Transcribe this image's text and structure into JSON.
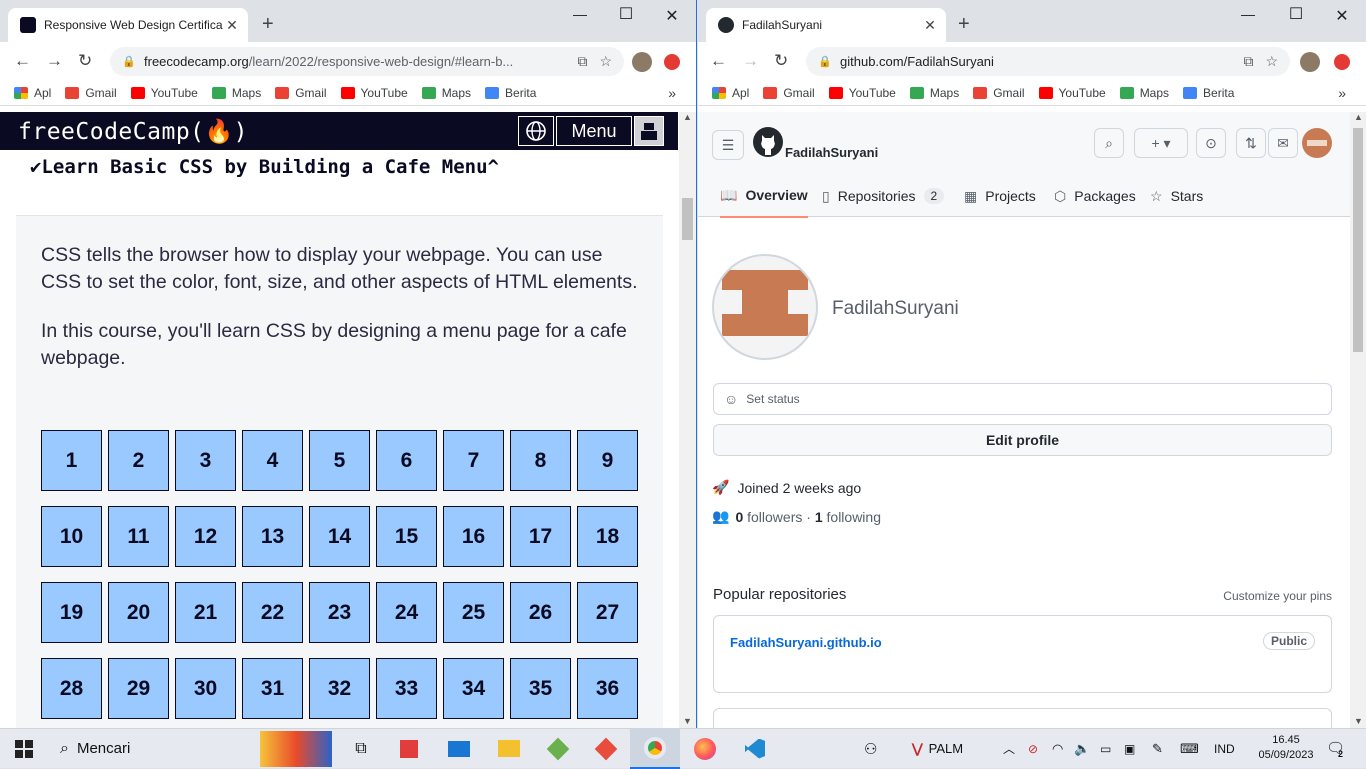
{
  "left_browser": {
    "tab_title": "Responsive Web Design Certifica",
    "url_host": "freecodecamp.org",
    "url_path": "/learn/2022/responsive-web-design/#learn-b...",
    "bookmarks": [
      "Apl",
      "Gmail",
      "YouTube",
      "Maps",
      "Gmail",
      "YouTube",
      "Maps",
      "Berita"
    ],
    "page": {
      "logo": "freeCodeCamp(🔥)",
      "menu_label": "Menu",
      "course_title": "✔Learn Basic CSS by Building a Cafe Menu^",
      "para1": "CSS tells the browser how to display your webpage. You can use CSS to set the color, font, size, and other aspects of HTML elements.",
      "para2": "In this course, you'll learn CSS by designing a menu page for a cafe webpage.",
      "steps": [
        "1",
        "2",
        "3",
        "4",
        "5",
        "6",
        "7",
        "8",
        "9",
        "10",
        "11",
        "12",
        "13",
        "14",
        "15",
        "16",
        "17",
        "18",
        "19",
        "20",
        "21",
        "22",
        "23",
        "24",
        "25",
        "26",
        "27",
        "28",
        "29",
        "30",
        "31",
        "32",
        "33",
        "34",
        "35",
        "36"
      ]
    }
  },
  "right_browser": {
    "tab_title": "FadilahSuryani",
    "url": "github.com/FadilahSuryani",
    "bookmarks": [
      "Apl",
      "Gmail",
      "YouTube",
      "Maps",
      "Gmail",
      "YouTube",
      "Maps",
      "Berita"
    ],
    "page": {
      "username_header": "FadilahSuryani",
      "tabs": [
        {
          "label": "Overview",
          "icon": "book-icon"
        },
        {
          "label": "Repositories",
          "icon": "repo-icon",
          "count": "2"
        },
        {
          "label": "Projects",
          "icon": "table-icon"
        },
        {
          "label": "Packages",
          "icon": "package-icon"
        },
        {
          "label": "Stars",
          "icon": "star-icon"
        }
      ],
      "profile_name": "FadilahSuryani",
      "set_status": "Set status",
      "edit_profile": "Edit profile",
      "joined": "Joined 2 weeks ago",
      "followers_count": "0",
      "followers_label": "followers",
      "following_count": "1",
      "following_label": "following",
      "popular_title": "Popular repositories",
      "customize": "Customize your pins",
      "repo_name": "FadilahSuryani.github.io",
      "repo_badge": "Public"
    }
  },
  "taskbar": {
    "search_label": "Mencari",
    "tray_app": "PALM",
    "lang": "IND",
    "time": "16.45",
    "date": "05/09/2023",
    "notif_count": "2"
  },
  "colors": {
    "fcc_nav": "#0a0a23",
    "fcc_cell": "#99c9ff",
    "gh_link": "#0969da",
    "gh_accent": "#fd8c73",
    "avatar_brown": "#c87b52"
  }
}
